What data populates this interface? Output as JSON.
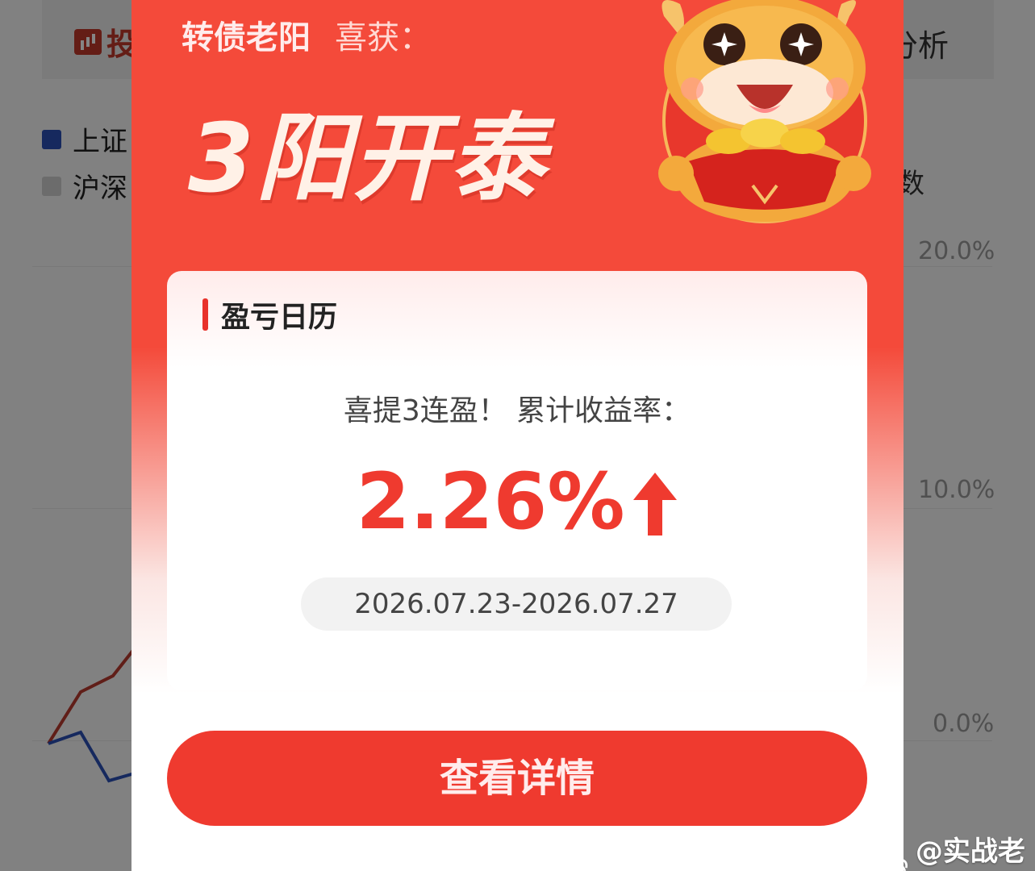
{
  "background": {
    "header_left_tab": "投",
    "header_right_tab": "分析",
    "legend": [
      {
        "label": "上证",
        "color": "#2b4fb5"
      },
      {
        "label": "沪深",
        "color": "#cfcfcf"
      }
    ],
    "right_partial_text": "数",
    "y_ticks": [
      "20.0%",
      "10.0%",
      "0.0%"
    ]
  },
  "popup": {
    "username": "转债老阳",
    "award_label": "喜获：",
    "headline": "3阳开泰",
    "card": {
      "title": "盈亏日历",
      "subtitle": "喜提3连盈！ 累计收益率：",
      "return_value": "2.26%",
      "date_range": "2026.07.23-2026.07.27"
    },
    "cta_label": "查看详情"
  },
  "watermark": {
    "text": "@实战老阳"
  },
  "colors": {
    "popup_red": "#f44a3a",
    "accent_red": "#ef3a2f",
    "series_red": "#b83a2e",
    "series_blue": "#2b4fb5"
  }
}
